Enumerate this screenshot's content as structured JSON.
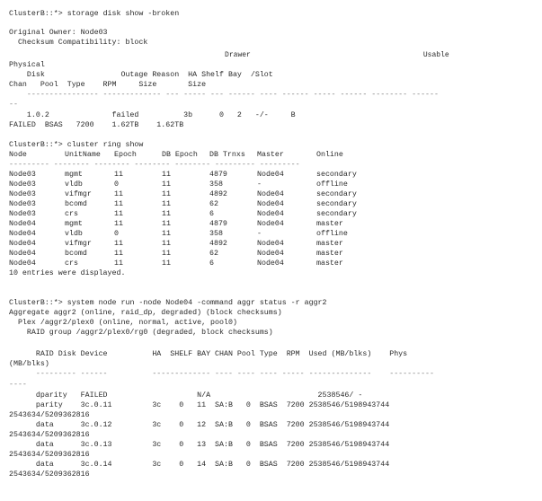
{
  "terminal": {
    "prompt": "ClusterB::*>",
    "sections": [
      {
        "command": "storage disk show -broken",
        "owner_line": "Original Owner: Node03",
        "checksum_line": "  Checksum Compatibility: block",
        "header_row1": "                                                  Drawer                                        Usable",
        "header_row2": "Physical",
        "header_row3": "    Disk                 Outage Reason  HA Shelf Bay  /Slot",
        "header_row4": "Chan   Pool  Type    RPM     Size       Size",
        "separator": "    ---------------- ------------- --- ----- --- ------ ---- ------ ----- ------ -------- ------",
        "separator_wrap": "--",
        "row_line1": "    1.0.2              failed          3b      0   2   -/-     B",
        "row_line2": "FAILED  BSAS   7200    1.62TB    1.62TB",
        "disk": {
          "name": "1.0.2",
          "outage_reason": "failed",
          "ha": "3b",
          "shelf": "0",
          "bay": "2",
          "slot": "-/-",
          "chan": "B",
          "pool": "FAILED",
          "type": "BSAS",
          "rpm": "7200",
          "usable_size": "1.62TB",
          "physical_size": "1.62TB"
        }
      },
      {
        "command": "cluster ring show",
        "columns": [
          "Node",
          "UnitName",
          "Epoch",
          "DB Epoch",
          "DB Trnxs",
          "Master",
          "Online"
        ],
        "separator": "--------- -------- -------- -------- -------- --------- ---------",
        "rows": [
          [
            "Node03",
            "mgmt",
            "11",
            "11",
            "4879",
            "Node04",
            "secondary"
          ],
          [
            "Node03",
            "vldb",
            "0",
            "11",
            "358",
            "-",
            "offline"
          ],
          [
            "Node03",
            "vifmgr",
            "11",
            "11",
            "4892",
            "Node04",
            "secondary"
          ],
          [
            "Node03",
            "bcomd",
            "11",
            "11",
            "62",
            "Node04",
            "secondary"
          ],
          [
            "Node03",
            "crs",
            "11",
            "11",
            "6",
            "Node04",
            "secondary"
          ],
          [
            "Node04",
            "mgmt",
            "11",
            "11",
            "4879",
            "Node04",
            "master"
          ],
          [
            "Node04",
            "vldb",
            "0",
            "11",
            "358",
            "-",
            "offline"
          ],
          [
            "Node04",
            "vifmgr",
            "11",
            "11",
            "4892",
            "Node04",
            "master"
          ],
          [
            "Node04",
            "bcomd",
            "11",
            "11",
            "62",
            "Node04",
            "master"
          ],
          [
            "Node04",
            "crs",
            "11",
            "11",
            "6",
            "Node04",
            "master"
          ]
        ],
        "footer": "10 entries were displayed."
      },
      {
        "command": "system node run -node Node04 -command aggr status -r aggr2",
        "aggregate_line": "Aggregate aggr2 (online, raid_dp, degraded) (block checksums)",
        "plex_line": "  Plex /aggr2/plex0 (online, normal, active, pool0)",
        "raid_group_line": "    RAID group /aggr2/plex0/rg0 (degraded, block checksums)",
        "header_line": "      RAID Disk Device          HA  SHELF BAY CHAN Pool Type  RPM  Used (MB/blks)    Phys",
        "header_wrap": "(MB/blks)",
        "separator": "      --------- ------          ------------- ---- ---- ---- ----- --------------    ----------",
        "separator_wrap": "----",
        "rows": [
          {
            "line": "      dparity   FAILED                    N/A                        2538546/ -",
            "wrap": null
          },
          {
            "line": "      parity    3c.0.11         3c    0   11  SA:B   0  BSAS  7200 2538546/5198943744",
            "wrap": "2543634/5209362816"
          },
          {
            "line": "      data      3c.0.12         3c    0   12  SA:B   0  BSAS  7200 2538546/5198943744",
            "wrap": "2543634/5209362816"
          },
          {
            "line": "      data      3c.0.13         3c    0   13  SA:B   0  BSAS  7200 2538546/5198943744",
            "wrap": "2543634/5209362816"
          },
          {
            "line": "      data      3c.0.14         3c    0   14  SA:B   0  BSAS  7200 2538546/5198943744",
            "wrap": "2543634/5209362816"
          }
        ]
      }
    ]
  }
}
